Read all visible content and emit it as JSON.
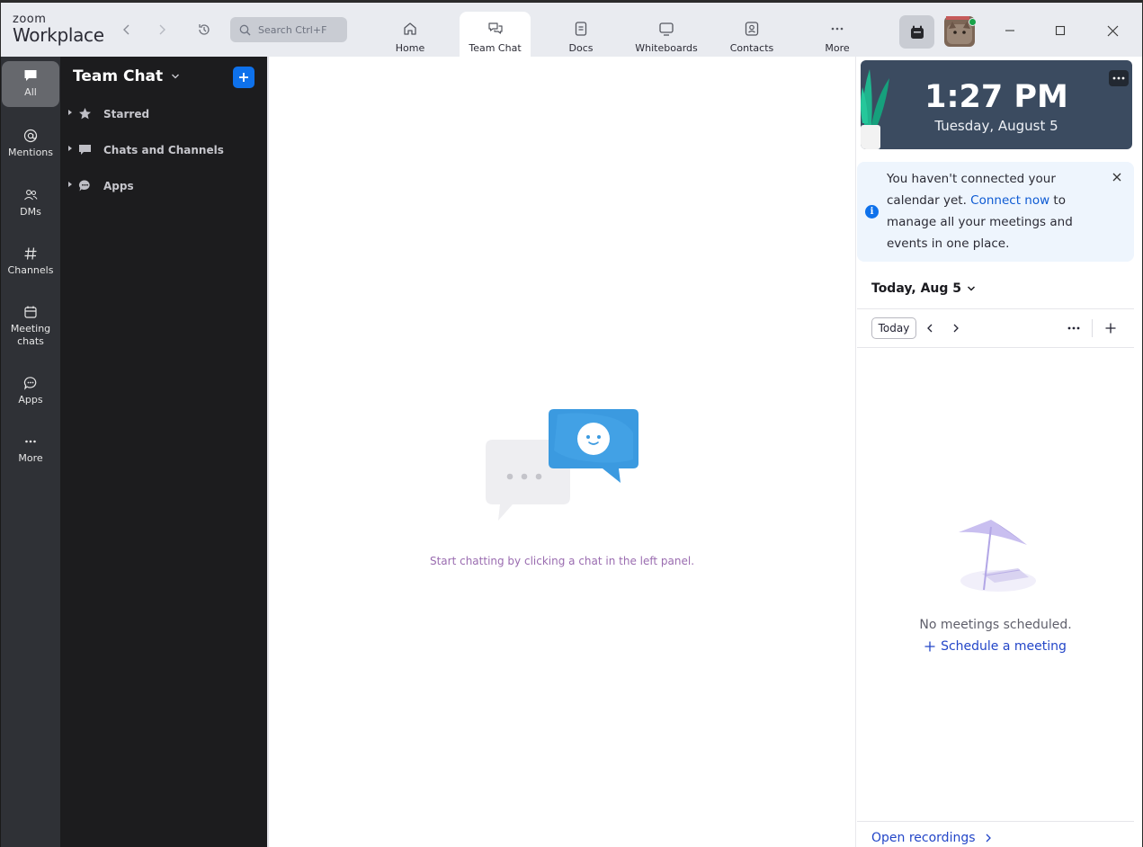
{
  "app": {
    "logo_line1": "zoom",
    "logo_line2": "Workplace"
  },
  "search": {
    "placeholder": "Search Ctrl+F"
  },
  "tabs": [
    {
      "label": "Home",
      "icon": "home-icon"
    },
    {
      "label": "Team Chat",
      "icon": "chat-icon",
      "active": true
    },
    {
      "label": "Docs",
      "icon": "doc-icon"
    },
    {
      "label": "Whiteboards",
      "icon": "whiteboard-icon"
    },
    {
      "label": "Contacts",
      "icon": "contacts-icon"
    },
    {
      "label": "More",
      "icon": "more-icon"
    }
  ],
  "rail": [
    {
      "label": "All",
      "icon": "chat-bubble-icon",
      "active": true
    },
    {
      "label": "Mentions",
      "icon": "at-icon"
    },
    {
      "label": "DMs",
      "icon": "people-icon"
    },
    {
      "label": "Channels",
      "icon": "hash-icon"
    },
    {
      "label": "Meeting chats",
      "line1": "Meeting",
      "line2": "chats",
      "icon": "calendar-icon"
    },
    {
      "label": "Apps",
      "icon": "apps-icon"
    },
    {
      "label": "More",
      "icon": "more-icon"
    }
  ],
  "sidebar": {
    "title": "Team Chat",
    "sections": [
      {
        "label": "Starred",
        "icon": "star-icon"
      },
      {
        "label": "Chats and Channels",
        "icon": "chat-bubble-icon"
      },
      {
        "label": "Apps",
        "icon": "apps-icon"
      }
    ]
  },
  "main": {
    "hint": "Start chatting by clicking a chat in the left panel."
  },
  "right": {
    "clock_time": "1:27 PM",
    "clock_date": "Tuesday, August 5",
    "notice_before": "You haven't connected your calendar yet. ",
    "notice_link": "Connect now",
    "notice_after": " to manage all your meetings and events in one place.",
    "calendar_date": "Today, Aug 5",
    "today_button": "Today",
    "empty_text": "No meetings scheduled.",
    "schedule_link": "Schedule a meeting",
    "open_recordings": "Open recordings"
  },
  "colors": {
    "accent": "#0e71eb",
    "link": "#2346c8",
    "rail_bg": "#2f3136",
    "sidebar_bg": "#1c1c1e",
    "hint": "#9a6cb0",
    "online": "#1aa34a"
  }
}
